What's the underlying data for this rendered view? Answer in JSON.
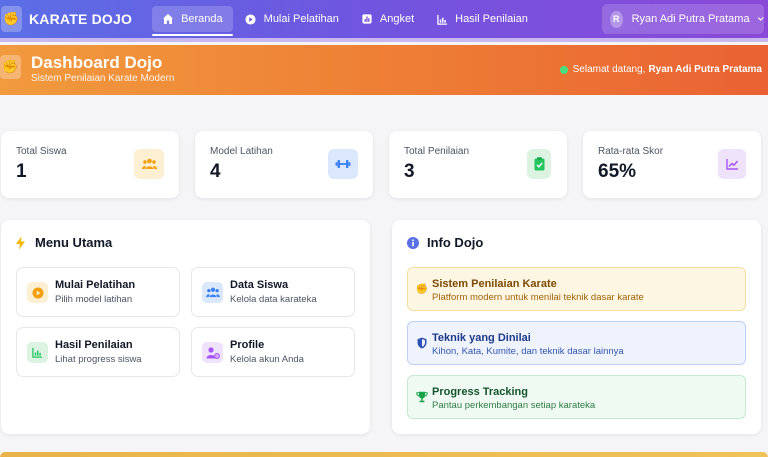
{
  "nav": {
    "brand": "KARATE DOJO",
    "items": [
      {
        "label": "Beranda",
        "icon": "home-icon"
      },
      {
        "label": "Mulai Pelatihan",
        "icon": "play-circle-icon"
      },
      {
        "label": "Angket",
        "icon": "poll-icon"
      },
      {
        "label": "Hasil Penilaian",
        "icon": "chart-icon"
      }
    ],
    "user": {
      "initial": "R",
      "name": "Ryan Adi Putra Pratama"
    }
  },
  "banner": {
    "title": "Dashboard Dojo",
    "subtitle": "Sistem Penilaian Karate Modern",
    "welcome_prefix": "Selamat datang,",
    "welcome_name": "Ryan Adi Putra Pratama"
  },
  "stats": [
    {
      "label": "Total Siswa",
      "value": "1",
      "icon": "users-icon",
      "color": "#f59e0b"
    },
    {
      "label": "Model Latihan",
      "value": "4",
      "icon": "dumbbell-icon",
      "color": "#3b82f6"
    },
    {
      "label": "Total Penilaian",
      "value": "3",
      "icon": "clipboard-check-icon",
      "color": "#22c55e"
    },
    {
      "label": "Rata-rata Skor",
      "value": "65%",
      "icon": "chart-line-icon",
      "color": "#a855f7"
    }
  ],
  "menu": {
    "title": "Menu Utama",
    "items": [
      {
        "title": "Mulai Pelatihan",
        "sub": "Pilih model latihan"
      },
      {
        "title": "Data Siswa",
        "sub": "Kelola data karateka"
      },
      {
        "title": "Hasil Penilaian",
        "sub": "Lihat progress siswa"
      },
      {
        "title": "Profile",
        "sub": "Kelola akun Anda"
      }
    ]
  },
  "info": {
    "title": "Info Dojo",
    "items": [
      {
        "title": "Sistem Penilaian Karate",
        "sub": "Platform modern untuk menilai teknik dasar karate"
      },
      {
        "title": "Teknik yang Dinilai",
        "sub": "Kihon, Kata, Kumite, dan teknik dasar lainnya"
      },
      {
        "title": "Progress Tracking",
        "sub": "Pantau perkembangan setiap karateka"
      }
    ]
  }
}
